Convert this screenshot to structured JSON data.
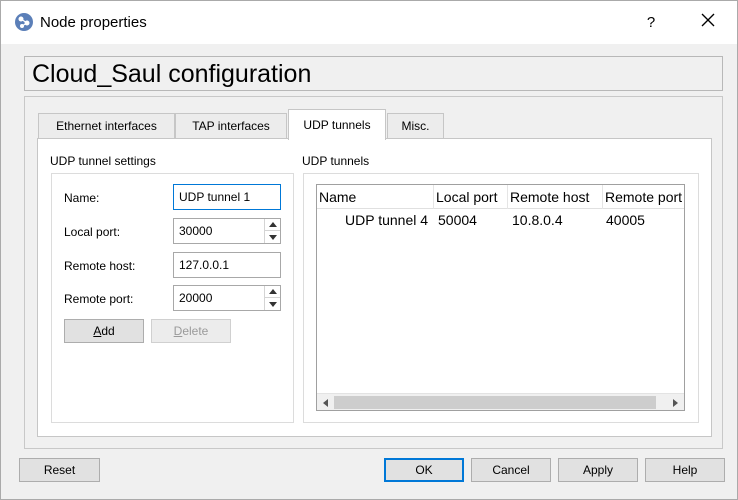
{
  "window": {
    "title": "Node properties",
    "help_label": "?"
  },
  "header": {
    "title": "Cloud_Saul configuration"
  },
  "tabs": [
    {
      "label": "Ethernet interfaces",
      "active": false
    },
    {
      "label": "TAP interfaces",
      "active": false
    },
    {
      "label": "UDP tunnels",
      "active": true
    },
    {
      "label": "Misc.",
      "active": false
    }
  ],
  "settings": {
    "group_title": "UDP tunnel settings",
    "name_label": "Name:",
    "name_value": "UDP tunnel 1",
    "local_port_label": "Local port:",
    "local_port_value": "30000",
    "remote_host_label": "Remote host:",
    "remote_host_value": "127.0.0.1",
    "remote_port_label": "Remote port:",
    "remote_port_value": "20000",
    "add_label": "Add",
    "delete_label": "Delete"
  },
  "tunnels": {
    "group_title": "UDP tunnels",
    "columns": [
      "Name",
      "Local port",
      "Remote host",
      "Remote port"
    ],
    "rows": [
      [
        "UDP tunnel 4",
        "50004",
        "10.8.0.4",
        "40005"
      ]
    ]
  },
  "footer": {
    "reset_label": "Reset",
    "ok_label": "OK",
    "cancel_label": "Cancel",
    "apply_label": "Apply",
    "help_label": "Help"
  },
  "colors": {
    "accent": "#0078d7",
    "icon_blue": "#4a6fa5"
  }
}
